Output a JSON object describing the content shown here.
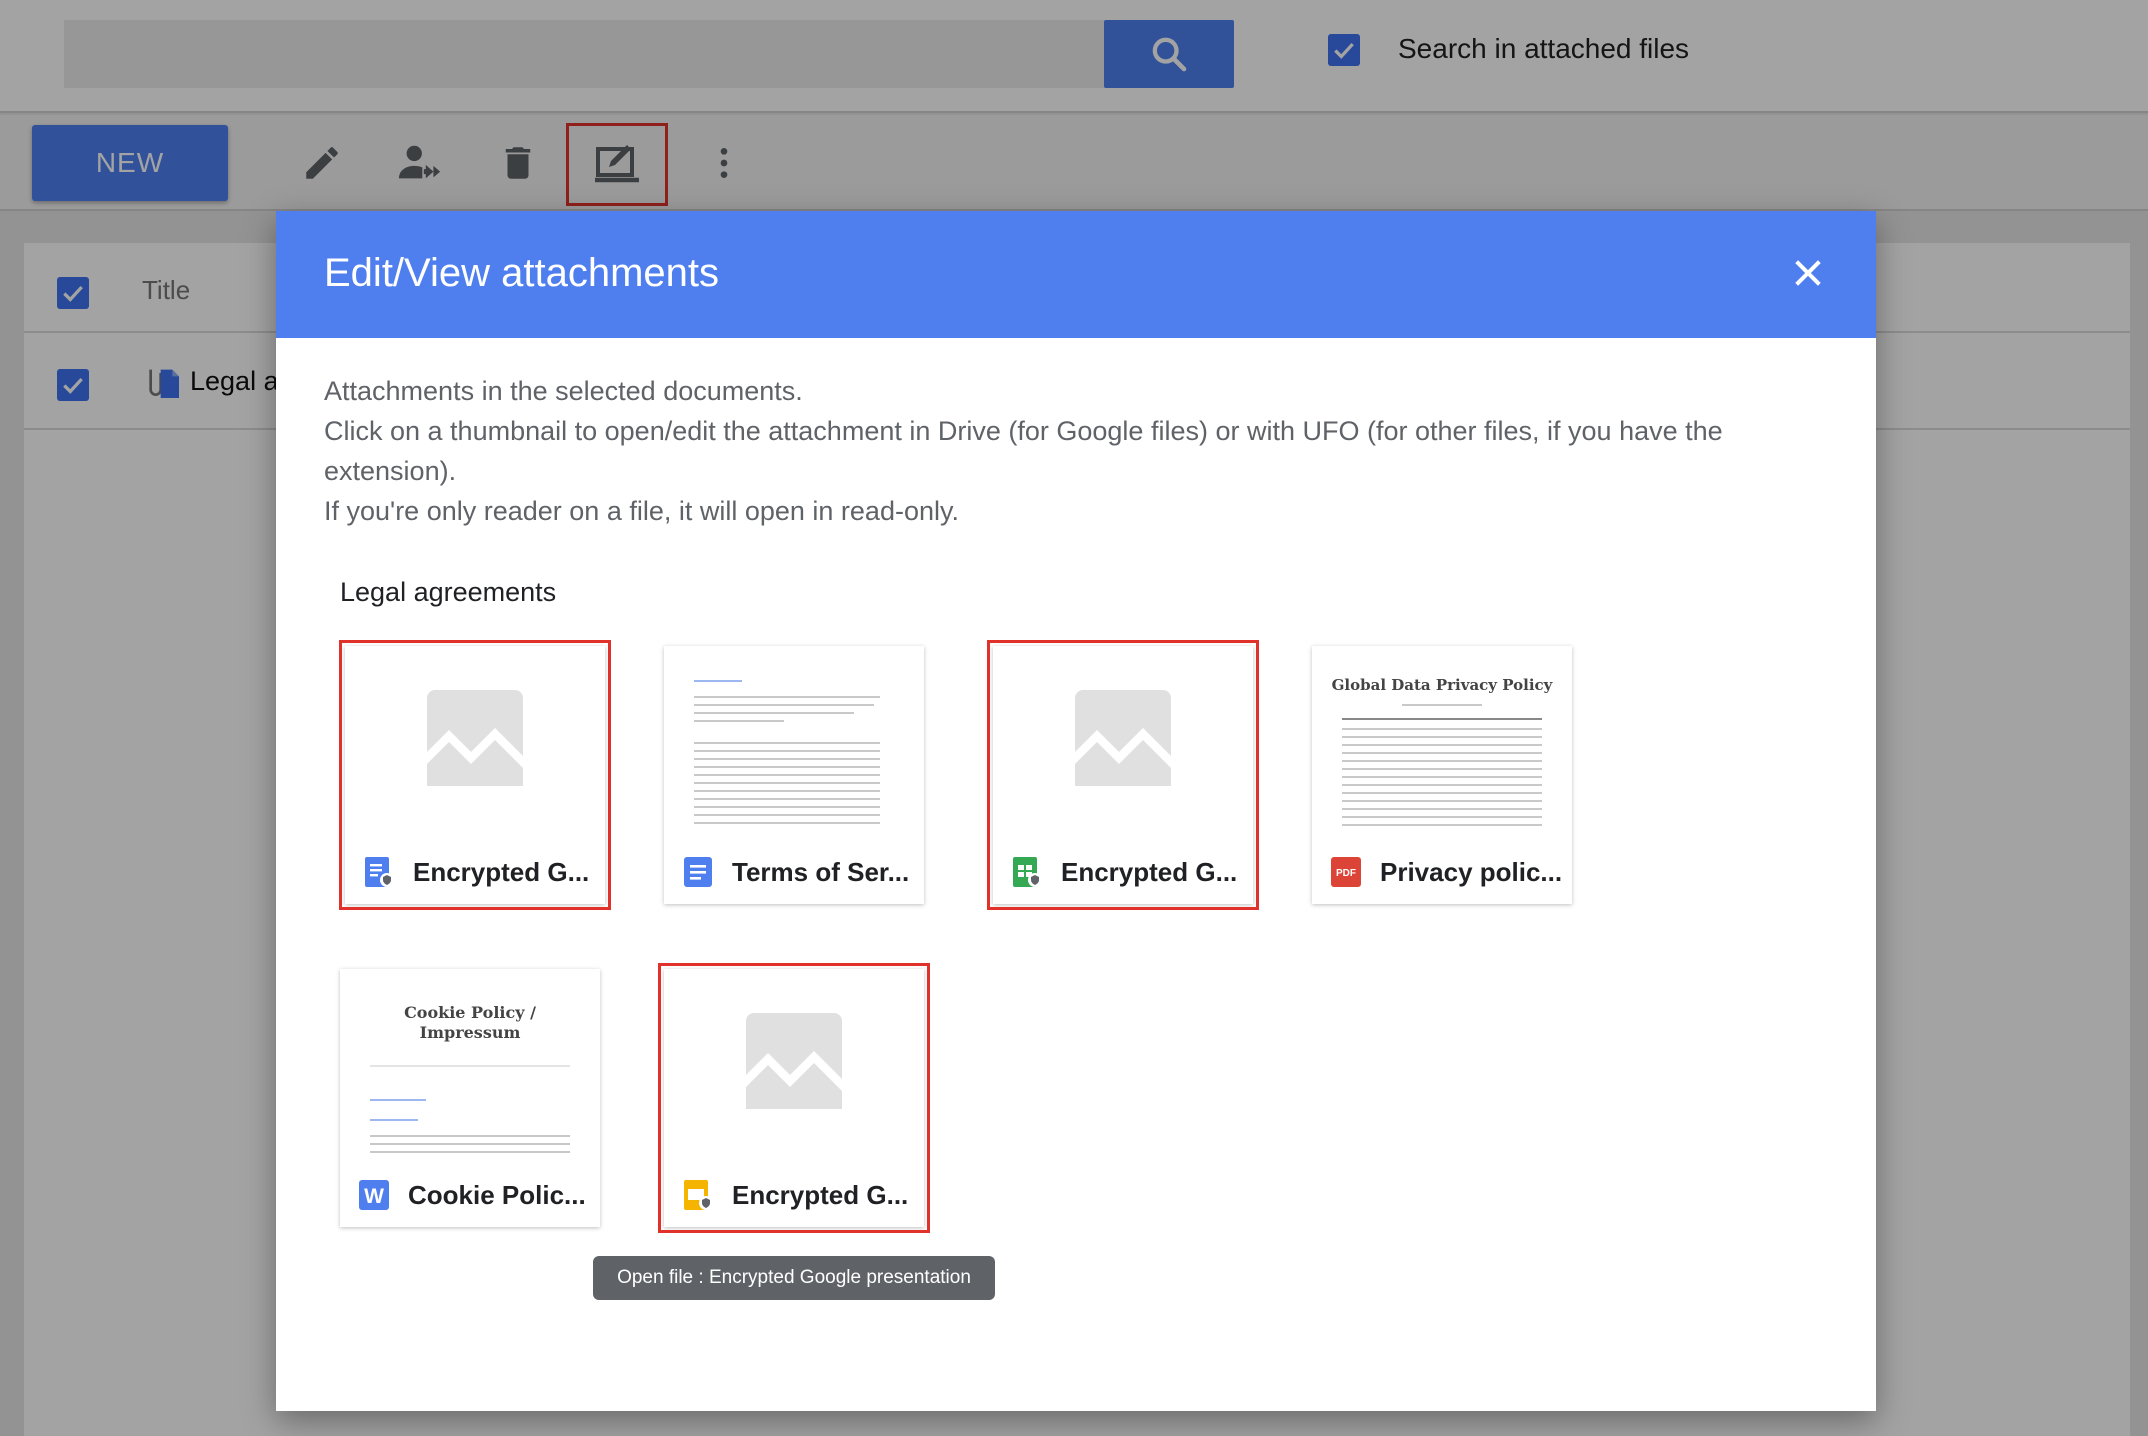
{
  "search": {
    "placeholder": "",
    "checkbox_label": "Search in attached files",
    "checked": true
  },
  "toolbar": {
    "new_label": "NEW",
    "tools": [
      {
        "icon": "pencil-icon",
        "label": "Edit"
      },
      {
        "icon": "person-share-icon",
        "label": "Share"
      },
      {
        "icon": "trash-icon",
        "label": "Delete"
      },
      {
        "icon": "edit-attachments-icon",
        "label": "Edit/View attachments"
      },
      {
        "icon": "more-vertical-icon",
        "label": "More"
      }
    ]
  },
  "list": {
    "header_title": "Title",
    "rows": [
      {
        "title": "Legal a",
        "checked": true
      }
    ]
  },
  "modal": {
    "title": "Edit/View attachments",
    "description": [
      "Attachments in the selected documents.",
      "Click on a thumbnail to open/edit the attachment in Drive (for Google files) or with UFO (for other files, if you have the extension).",
      "If you're only reader on a file, it will open in read-only."
    ],
    "group_title": "Legal agreements",
    "files": [
      {
        "name": "Encrypted G...",
        "icon": "encrypted-doc-icon",
        "thumbnail": "placeholder",
        "selected": true
      },
      {
        "name": "Terms of Ser...",
        "icon": "google-docs-icon",
        "thumbnail": "document",
        "selected": false
      },
      {
        "name": "Encrypted G...",
        "icon": "encrypted-sheet-icon",
        "thumbnail": "placeholder",
        "selected": true
      },
      {
        "name": "Privacy polic...",
        "icon": "pdf-icon",
        "thumbnail": "document",
        "thumb_title": "Global Data Privacy Policy",
        "selected": false
      },
      {
        "name": "Cookie Polic...",
        "icon": "word-icon",
        "thumbnail": "document",
        "thumb_title": "Cookie Policy / Impressum",
        "selected": false
      },
      {
        "name": "Encrypted G...",
        "icon": "encrypted-slides-icon",
        "thumbnail": "placeholder",
        "selected": true
      }
    ],
    "tooltip": "Open file : Encrypted Google presentation"
  },
  "colors": {
    "primary": "#4f7fef",
    "highlight": "#e0322b",
    "checkbox": "#3f72f0",
    "pdf": "#db4437",
    "sheets": "#34a853",
    "slides": "#f4b400"
  }
}
